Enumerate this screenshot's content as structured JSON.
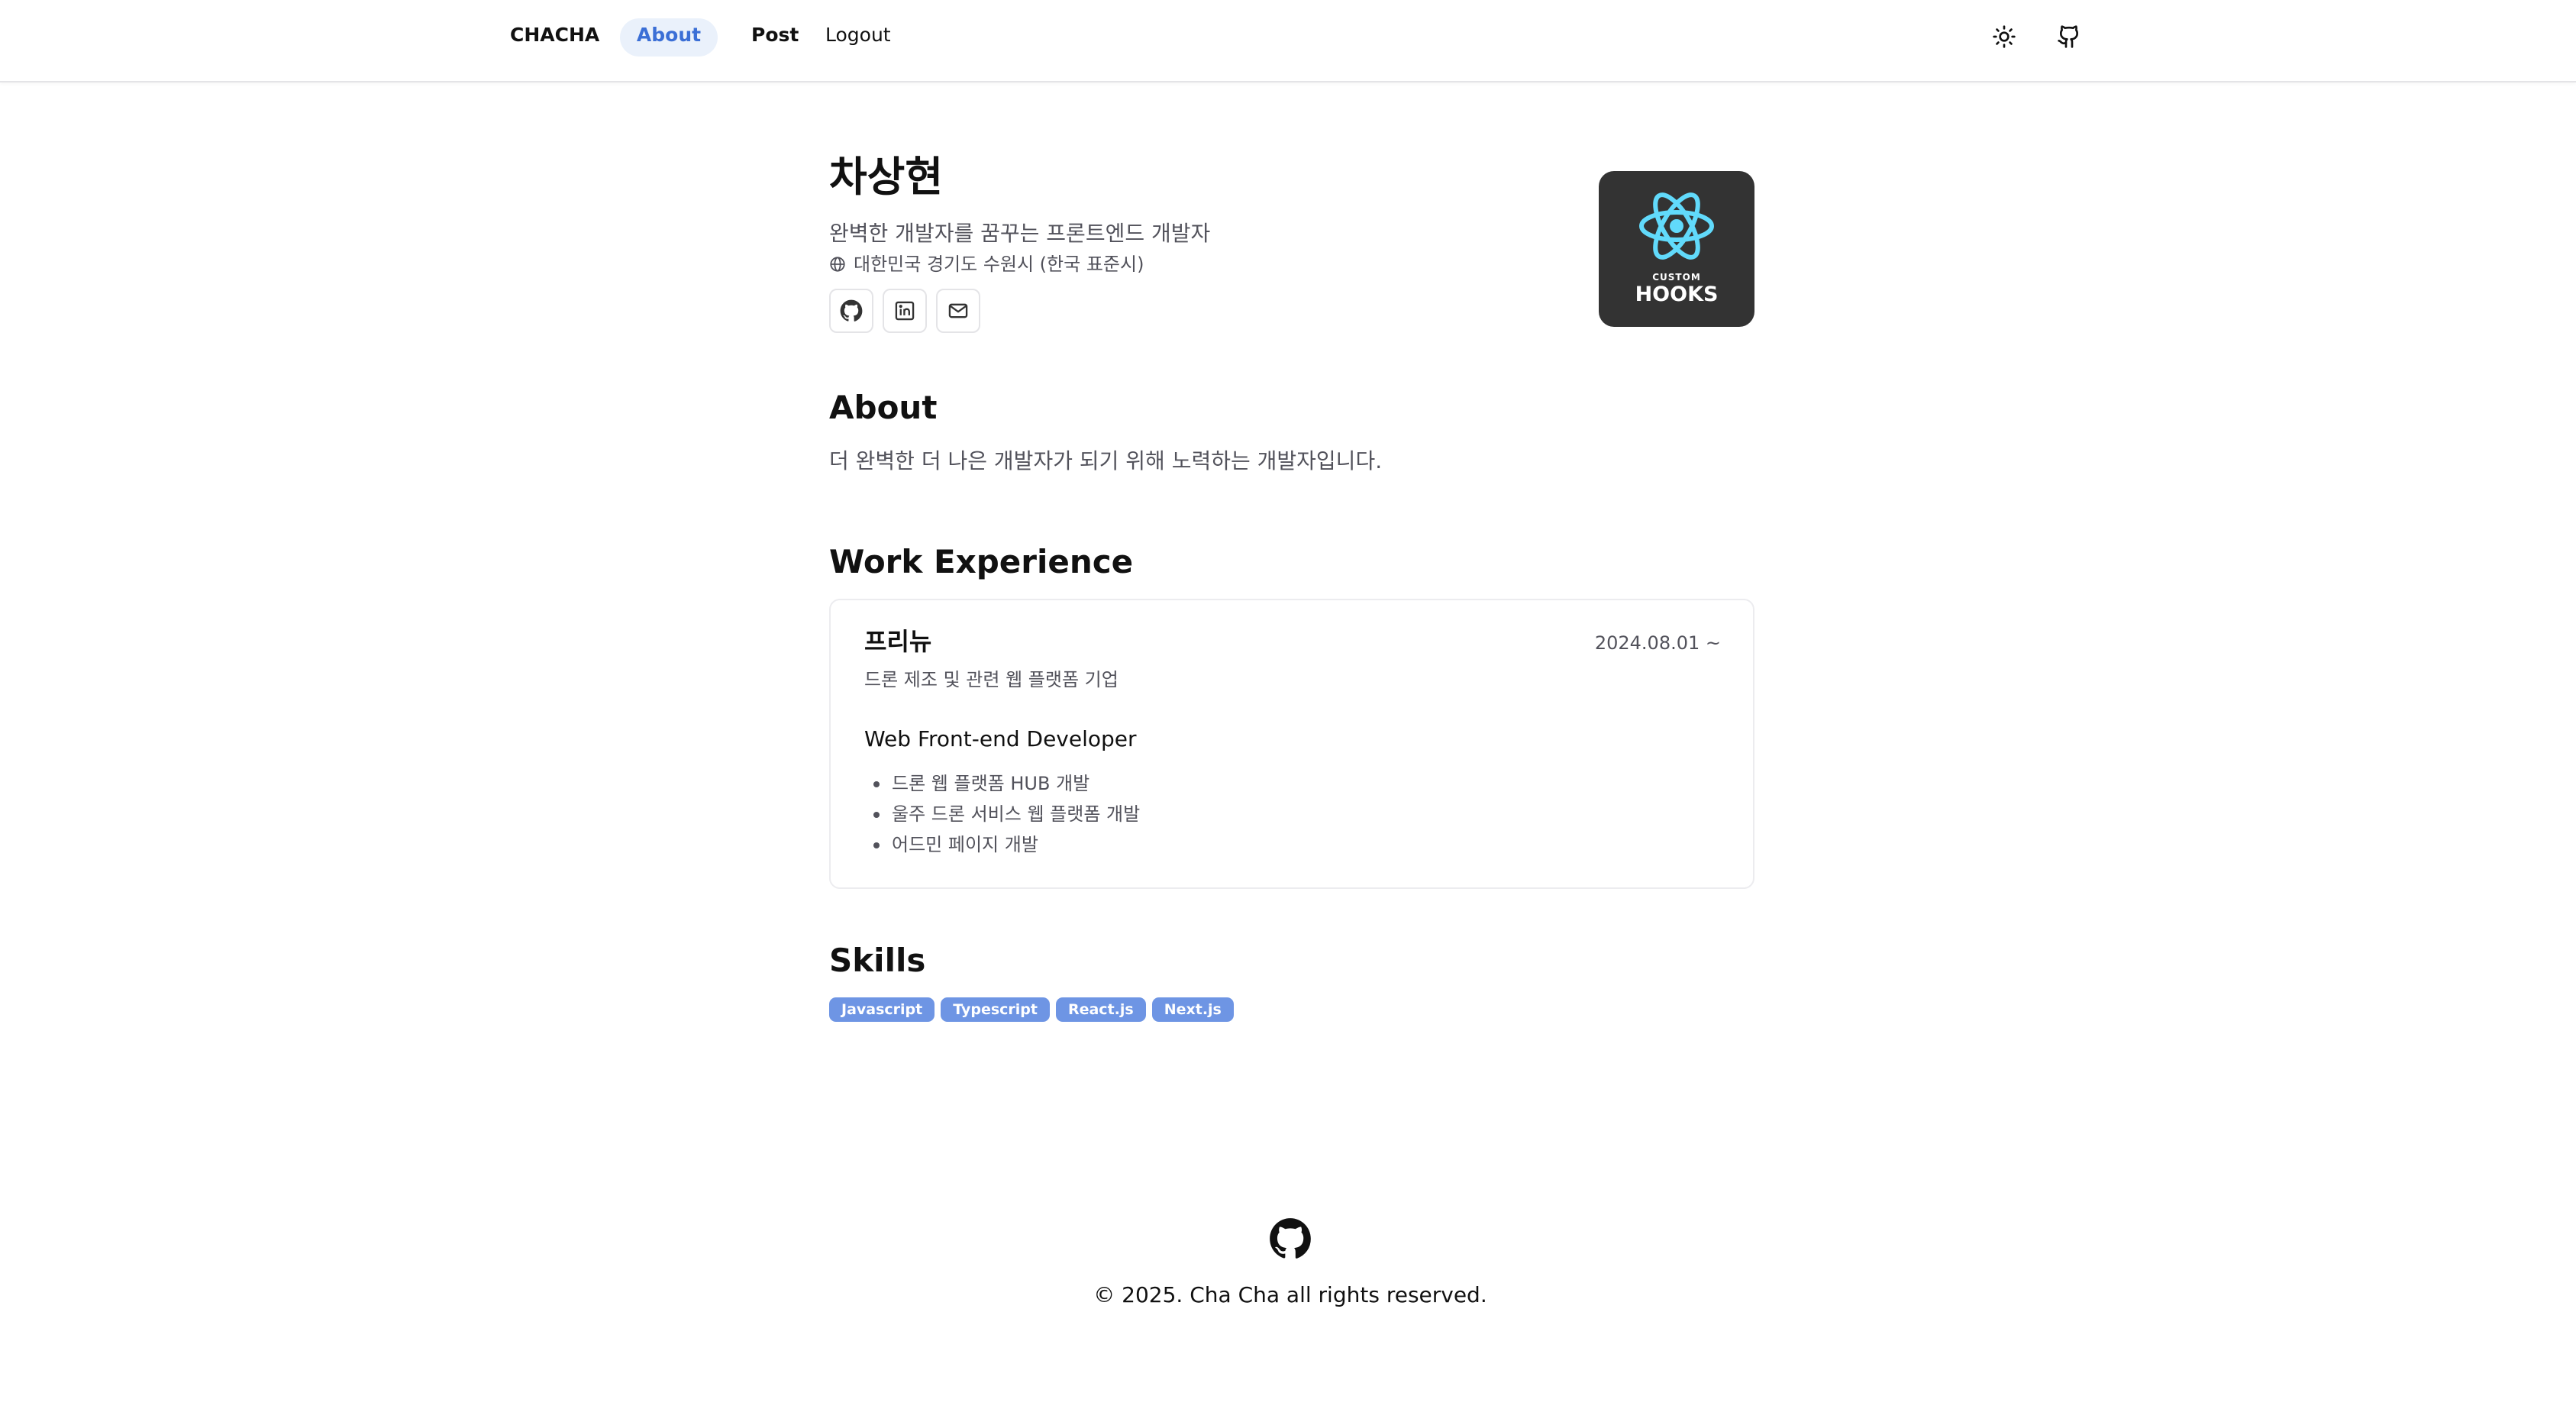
{
  "header": {
    "brand": "CHACHA",
    "nav": {
      "about": "About",
      "post": "Post",
      "logout": "Logout"
    },
    "icons": [
      "sun-icon",
      "github-icon"
    ]
  },
  "profile": {
    "name": "차상현",
    "tagline": "완벽한 개발자를 꿈꾸는 프론트엔드 개발자",
    "location": "대한민국 경기도 수원시 (한국 표준시)",
    "social_icons": [
      "github-icon",
      "linkedin-icon",
      "mail-icon"
    ],
    "avatar": {
      "small_text": "CUSTOM",
      "big_text": "HOOKS",
      "atom_color": "#61dafb"
    }
  },
  "about": {
    "title": "About",
    "text": "더 완벽한 더 나은 개발자가 되기 위해 노력하는 개발자입니다."
  },
  "work": {
    "title": "Work Experience",
    "entries": [
      {
        "company": "프리뉴",
        "date": "2024.08.01 ~",
        "description": "드론 제조 및 관련 웹 플랫폼 기업",
        "role": "Web Front-end Developer",
        "tasks": [
          "드론 웹 플랫폼 HUB 개발",
          "울주 드론 서비스 웹 플랫폼 개발",
          "어드민 페이지 개발"
        ]
      }
    ]
  },
  "skills": {
    "title": "Skills",
    "items": [
      "Javascript",
      "Typescript",
      "React.js",
      "Next.js"
    ],
    "badge_color": "#6e95e4"
  },
  "footer": {
    "copyright": "© 2025. Cha Cha all rights reserved."
  },
  "colors": {
    "accent": "#3b6fd6",
    "accent_bg": "#eaf1fb"
  }
}
